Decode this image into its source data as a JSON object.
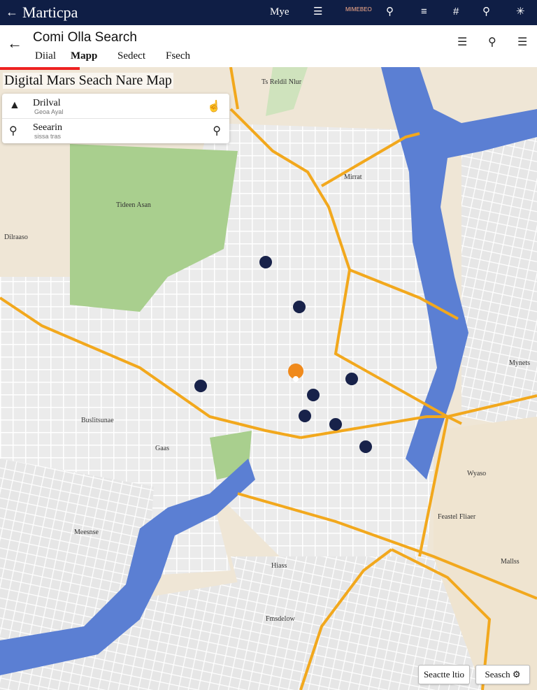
{
  "top_bar": {
    "back_icon": "arrow-left-icon",
    "app_title": "Marticpa",
    "label": "Mye",
    "tiny_text": "MIMEBEO",
    "icons": [
      "list-icon",
      "search-icon",
      "filter-icon",
      "hash-icon",
      "search-icon",
      "network-icon"
    ]
  },
  "header": {
    "title": "Comi Olla Search",
    "tabs": [
      {
        "label": "Diial",
        "active": false
      },
      {
        "label": "Mapp",
        "active": true
      },
      {
        "label": "Sedect",
        "active": false
      },
      {
        "label": "Fsech",
        "active": false
      }
    ]
  },
  "map_title": "Digital Mars Seach Nare Map",
  "search_panel": {
    "rows": [
      {
        "label": "Drilval",
        "sublabel": "Geoa Ayal",
        "icon": "location-icon",
        "action_icon": "hand-icon"
      },
      {
        "label": "Seearin",
        "sublabel": "sissa tras",
        "icon": "search-icon",
        "action_icon": "search-icon"
      }
    ]
  },
  "map_labels": {
    "park": "Tideen Asan",
    "district_nw": "Dilraaso",
    "top_area": "Ts Reldil Nlur",
    "mid_block": "Mirrat",
    "river_label": "Mynets",
    "sw_label": "Meesnse",
    "area_center": "Buslitsunae",
    "area_label2": "Gaas",
    "east_label": "Wyaso",
    "east_label2": "Feastel Fliaer",
    "south_label": "Hiass",
    "south_label2": "Mallss",
    "south_center": "Fmsdelow"
  },
  "buttons": {
    "search_here": "Seactte ltio",
    "search": "Seasch"
  },
  "colors": {
    "topbar": "#0f1e45",
    "river": "#5b7fd3",
    "park": "#a9cf8e",
    "road_major": "#f2a81d",
    "pin": "#18224a",
    "pin_selected": "#f08a1c"
  }
}
